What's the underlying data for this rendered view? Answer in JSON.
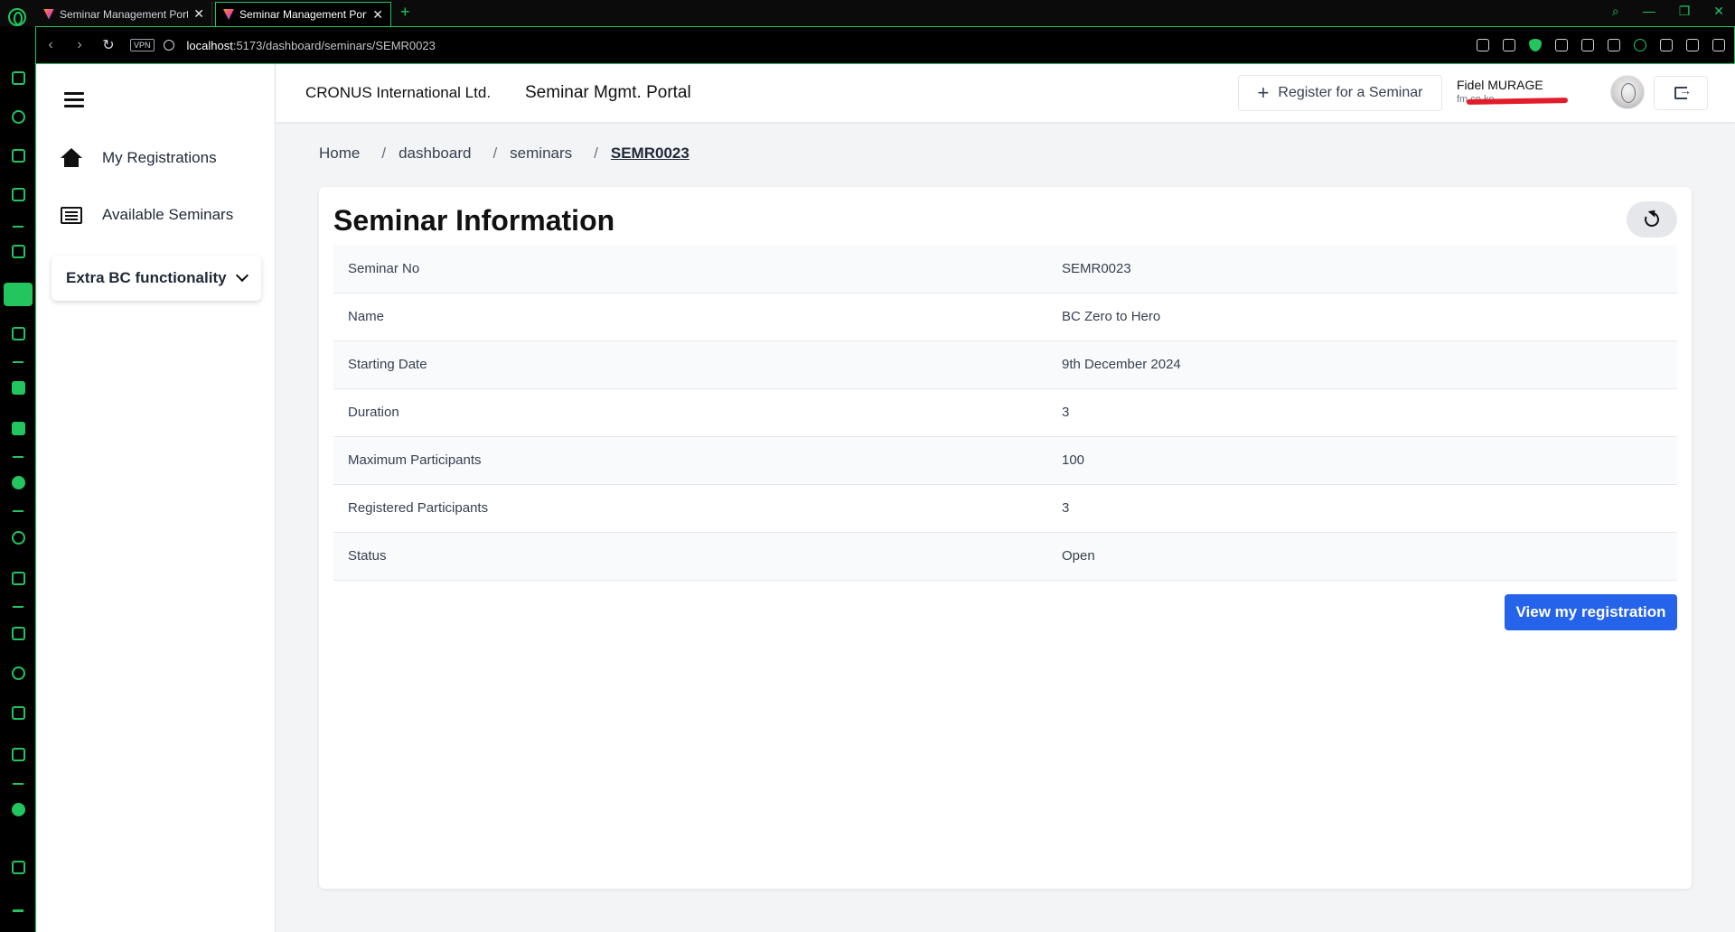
{
  "browser": {
    "tabs": [
      {
        "title": "Seminar Management Port",
        "active": false
      },
      {
        "title": "Seminar Management Port",
        "active": true
      }
    ],
    "vpn_label": "VPN",
    "url_host": "localhost",
    "url_path": ":5173/dashboard/seminars/SEMR0023",
    "accent_color": "#22c55e"
  },
  "sidebar": {
    "items": [
      {
        "label": "My Registrations",
        "icon": "home-icon"
      },
      {
        "label": "Available Seminars",
        "icon": "list-icon"
      }
    ],
    "dropdown": {
      "label": "Extra BC functionality"
    }
  },
  "header": {
    "company": "CRONUS International Ltd.",
    "portal": "Seminar Mgmt. Portal",
    "register_label": "Register for a Seminar",
    "user_name": "Fidel MURAGE",
    "user_email": "fm          co.ke"
  },
  "breadcrumb": {
    "items": [
      "Home",
      "dashboard",
      "seminars",
      "SEMR0023"
    ],
    "separator": "/"
  },
  "seminar": {
    "title": "Seminar Information",
    "rows": [
      {
        "label": "Seminar No",
        "value": "SEMR0023"
      },
      {
        "label": "Name",
        "value": "BC Zero to Hero"
      },
      {
        "label": "Starting Date",
        "value": "9th December 2024"
      },
      {
        "label": "Duration",
        "value": "3"
      },
      {
        "label": "Maximum Participants",
        "value": "100"
      },
      {
        "label": "Registered Participants",
        "value": "3"
      },
      {
        "label": "Status",
        "value": "Open"
      }
    ],
    "view_button": "View my registration"
  }
}
